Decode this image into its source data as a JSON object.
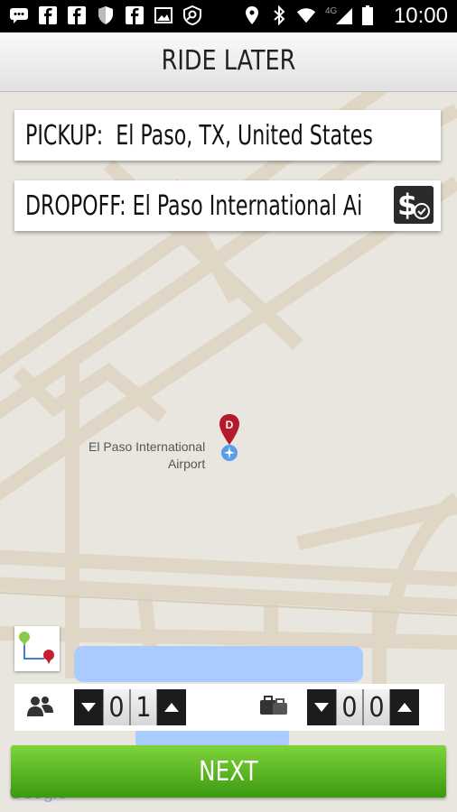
{
  "status_bar": {
    "time": "10:00",
    "network": "4G"
  },
  "header": {
    "title": "RIDE LATER"
  },
  "pickup": {
    "label": "PICKUP:",
    "value": "El Paso, TX, United States"
  },
  "dropoff": {
    "label": "DROPOFF:",
    "value": "El Paso International Ai"
  },
  "map": {
    "place_name_line1": "El Paso International",
    "place_name_line2": "Airport",
    "pin_letter": "D",
    "attribution": "Google"
  },
  "passengers": {
    "digits": [
      "0",
      "1"
    ]
  },
  "luggage": {
    "digits": [
      "0",
      "0"
    ]
  },
  "next_button": {
    "label": "NEXT"
  },
  "colors": {
    "accent_green": "#5bbf22",
    "map_bg": "#e9e6df",
    "road": "#e3dccf",
    "water": "#a9cbff",
    "pin_red": "#b5192b"
  },
  "icons": [
    "chat-icon",
    "facebook-icon",
    "facebook-icon",
    "shield-icon",
    "facebook-icon",
    "image-icon",
    "search-icon",
    "location-icon",
    "bluetooth-icon",
    "wifi-icon",
    "signal-icon",
    "battery-icon",
    "fare-estimate-icon",
    "route-icon",
    "people-icon",
    "luggage-icon"
  ]
}
